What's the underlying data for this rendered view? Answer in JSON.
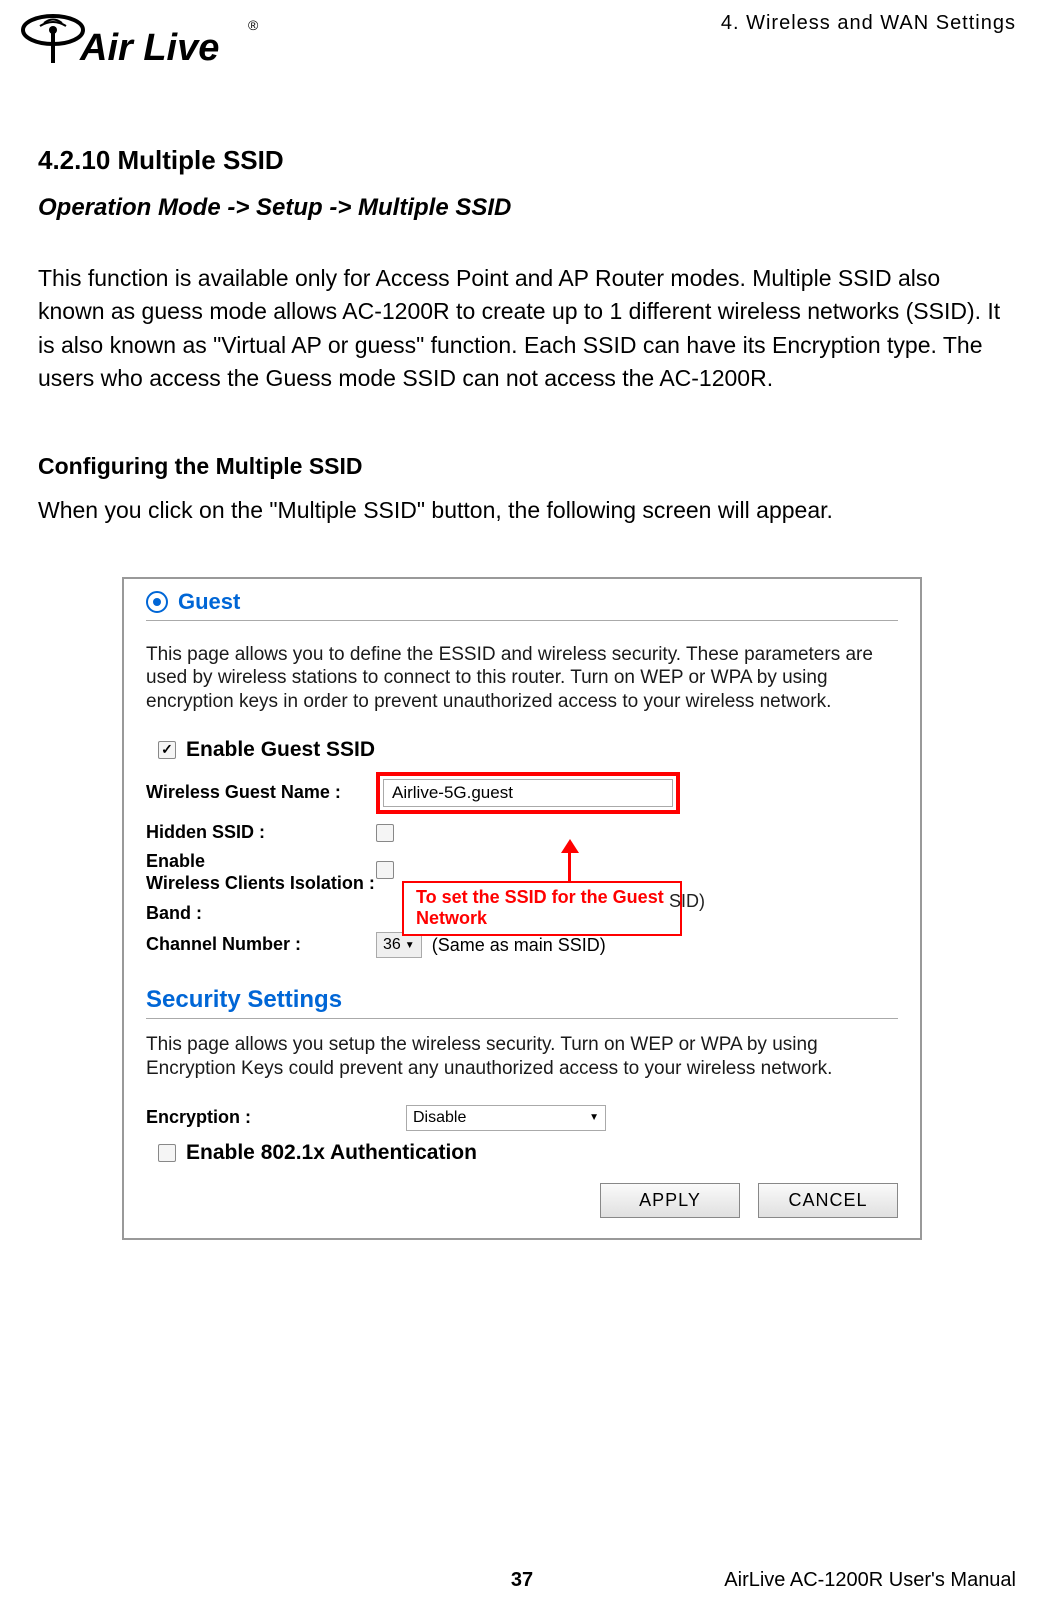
{
  "header": {
    "chapter": "4.  Wireless  and  WAN  Settings",
    "logo_text": "Air Live",
    "logo_r": "®"
  },
  "doc": {
    "section_number_title": "4.2.10 Multiple SSID",
    "breadcrumb": "Operation Mode -> Setup -> Multiple SSID",
    "intro": "This function is available only for Access Point and AP Router modes. Multiple SSID also known as guess mode allows AC-1200R to create up to 1 different wireless networks (SSID). It is also known as \"Virtual AP or guess\" function. Each SSID can have its Encryption type. The users who access the Guess mode SSID can not access the AC-1200R.",
    "sub_heading": "Configuring the Multiple SSID",
    "sub_text": "When you click on the \"Multiple SSID\" button, the following screen will appear."
  },
  "panel": {
    "title": "Guest",
    "desc": "This page allows you to define the ESSID and wireless security. These parameters are used by wireless stations to connect to this router.  Turn on WEP or WPA by using encryption keys in order to prevent unauthorized access to your wireless network.",
    "enable_label": "Enable Guest SSID",
    "wg_label": "Wireless Guest Name :",
    "wg_value": "Airlive-5G.guest",
    "hidden_label": "Hidden SSID :",
    "iso_label_line1": "Enable",
    "iso_label_line2": "Wireless Clients Isolation :",
    "band_label": "Band :",
    "band_note_partial": "SID)",
    "channel_label": "Channel Number :",
    "channel_value": "36",
    "channel_note": "(Same as main SSID)",
    "annotation": "To set the SSID for the Guest Network",
    "sec_title": "Security Settings",
    "sec_desc": "This page allows you setup the wireless security. Turn on WEP or WPA by using Encryption Keys could prevent any unauthorized access to your wireless network.",
    "enc_label": "Encryption :",
    "enc_value": "Disable",
    "auth_label": "Enable 802.1x Authentication",
    "apply": "APPLY",
    "cancel": "CANCEL"
  },
  "footer": {
    "page": "37",
    "manual": "AirLive AC-1200R User's Manual"
  }
}
